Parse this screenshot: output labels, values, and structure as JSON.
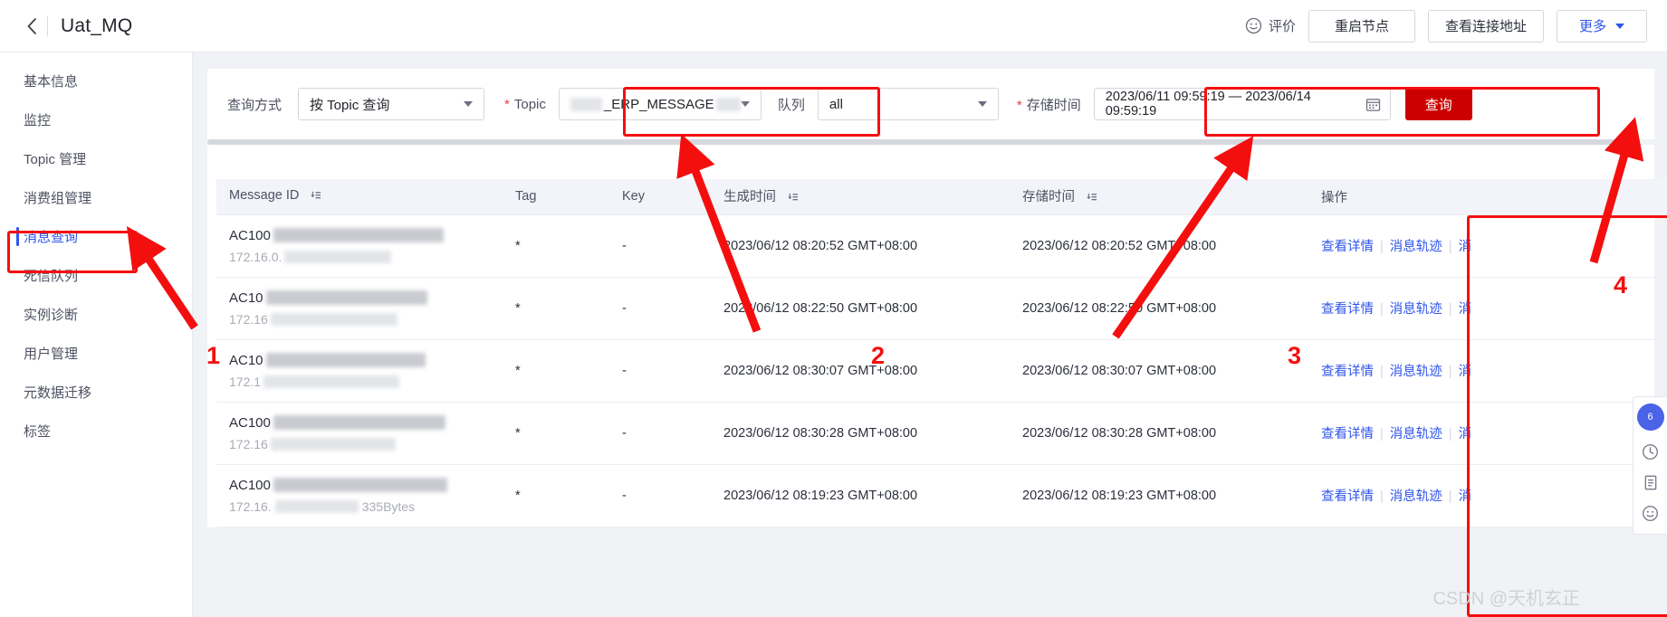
{
  "header": {
    "back_icon": "chevron-left-icon",
    "title": "Uat_MQ",
    "rate_label": "评价",
    "rate_icon": "smiley-icon",
    "buttons": [
      {
        "label": "重启节点",
        "name": "restart-node-button"
      },
      {
        "label": "查看连接地址",
        "name": "view-endpoint-button"
      }
    ],
    "more_label": "更多",
    "more_icon": "chevron-down-icon"
  },
  "sidebar": {
    "items": [
      {
        "label": "基本信息",
        "name": "sidebar-item-basic-info",
        "active": false
      },
      {
        "label": "监控",
        "name": "sidebar-item-monitor",
        "active": false
      },
      {
        "label": "Topic 管理",
        "name": "sidebar-item-topic-management",
        "active": false
      },
      {
        "label": "消费组管理",
        "name": "sidebar-item-consumer-group",
        "active": false
      },
      {
        "label": "消息查询",
        "name": "sidebar-item-message-query",
        "active": true
      },
      {
        "label": "死信队列",
        "name": "sidebar-item-dead-letter-queue",
        "active": false
      },
      {
        "label": "实例诊断",
        "name": "sidebar-item-instance-diagnosis",
        "active": false
      },
      {
        "label": "用户管理",
        "name": "sidebar-item-user-management",
        "active": false
      },
      {
        "label": "元数据迁移",
        "name": "sidebar-item-metadata-migration",
        "active": false
      },
      {
        "label": "标签",
        "name": "sidebar-item-tags",
        "active": false
      }
    ]
  },
  "filters": {
    "query_mode_label": "查询方式",
    "query_mode_value": "按 Topic 查询",
    "topic_label": "Topic",
    "topic_value": "_ERP_MESSAGE",
    "queue_label": "队列",
    "queue_value": "all",
    "store_time_label": "存储时间",
    "store_time_value": "2023/06/11 09:59:19 — 2023/06/14 09:59:19",
    "calendar_icon": "calendar-icon",
    "search_label": "查询"
  },
  "table": {
    "columns": [
      {
        "label": "Message ID",
        "name": "column-message-id",
        "sortable": true
      },
      {
        "label": "Tag",
        "name": "column-tag",
        "sortable": false
      },
      {
        "label": "Key",
        "name": "column-key",
        "sortable": false
      },
      {
        "label": "生成时间",
        "name": "column-create-time",
        "sortable": true
      },
      {
        "label": "存储时间",
        "name": "column-store-time",
        "sortable": true
      },
      {
        "label": "操作",
        "name": "column-operations",
        "sortable": false
      }
    ],
    "rows": [
      {
        "message_id_prefix": "AC100",
        "message_id_mask_w": 188,
        "ip_prefix": "172.16.0.",
        "ip_mask_w": 118,
        "tag": "*",
        "key": "-",
        "create_time": "2023/06/12 08:20:52 GMT+08:00",
        "store_time": "2023/06/12 08:20:52 GMT+08:00"
      },
      {
        "message_id_prefix": "AC10",
        "message_id_mask_w": 178,
        "ip_prefix": "172.16",
        "ip_mask_w": 140,
        "tag": "*",
        "key": "-",
        "create_time": "2023/06/12 08:22:50 GMT+08:00",
        "store_time": "2023/06/12 08:22:50 GMT+08:00"
      },
      {
        "message_id_prefix": "AC10",
        "message_id_mask_w": 176,
        "ip_prefix": "172.1",
        "ip_mask_w": 150,
        "tag": "*",
        "key": "-",
        "create_time": "2023/06/12 08:30:07 GMT+08:00",
        "store_time": "2023/06/12 08:30:07 GMT+08:00"
      },
      {
        "message_id_prefix": "AC100",
        "message_id_mask_w": 190,
        "ip_prefix": "172.16",
        "ip_mask_w": 138,
        "tag": "*",
        "key": "-",
        "create_time": "2023/06/12 08:30:28 GMT+08:00",
        "store_time": "2023/06/12 08:30:28 GMT+08:00"
      },
      {
        "message_id_prefix": "AC100",
        "message_id_mask_w": 192,
        "ip_prefix": "172.16.",
        "ip_mask_w": 126,
        "ip_suffix": "335Bytes",
        "tag": "*",
        "key": "-",
        "create_time": "2023/06/12 08:19:23 GMT+08:00",
        "store_time": "2023/06/12 08:19:23 GMT+08:00"
      }
    ],
    "operations": [
      {
        "label": "查看详情",
        "name": "row-action-view-detail"
      },
      {
        "label": "消息轨迹",
        "name": "row-action-message-trace"
      },
      {
        "label": "消",
        "name": "row-action-resend"
      }
    ],
    "op_separator": "|"
  },
  "annotations": {
    "numbers": [
      "1",
      "2",
      "3",
      "4"
    ]
  },
  "floatbar": {
    "badge": "6",
    "items": [
      {
        "name": "clock-icon"
      },
      {
        "name": "document-icon"
      },
      {
        "name": "smiley-icon"
      }
    ]
  },
  "watermark": "CSDN @天机玄正"
}
